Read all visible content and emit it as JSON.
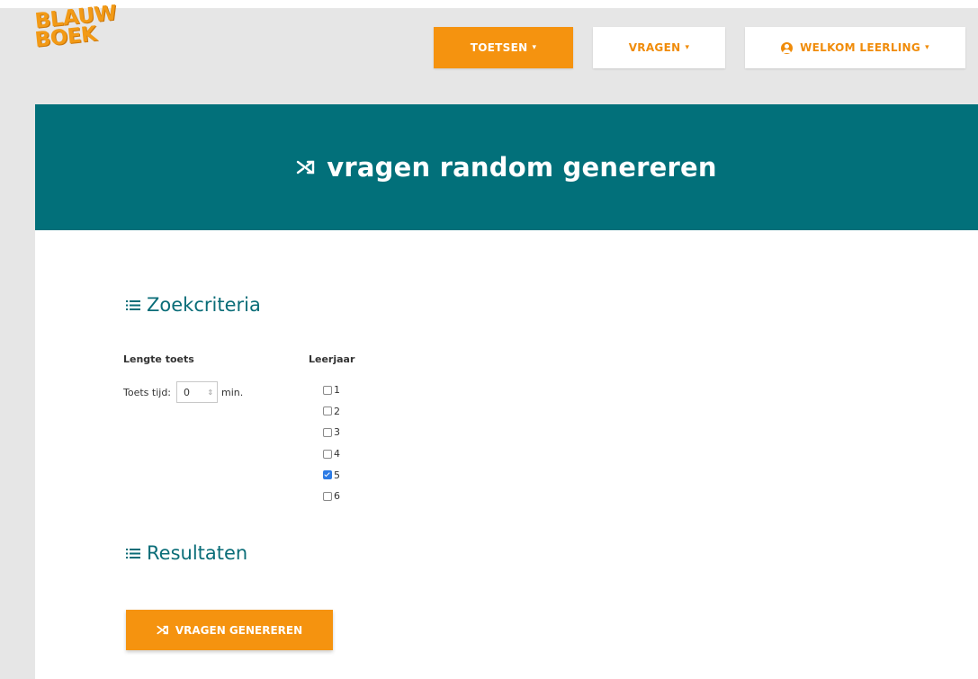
{
  "logo": {
    "line1": "BLAUW",
    "line2": "BOEK"
  },
  "nav": {
    "toetsen_label": "TOETSEN",
    "vragen_label": "VRAGEN",
    "welkom_label": "WELKOM LEERLING",
    "caret": "▾"
  },
  "hero": {
    "title": "vragen random genereren",
    "icon": "shuffle-icon"
  },
  "criteria": {
    "heading": "Zoekcriteria",
    "lengte_label": "Lengte toets",
    "time_label": "Toets tijd:",
    "time_value": "0",
    "time_unit": "min.",
    "leerjaar_label": "Leerjaar",
    "years": [
      {
        "label": "1",
        "checked": false
      },
      {
        "label": "2",
        "checked": false
      },
      {
        "label": "3",
        "checked": false
      },
      {
        "label": "4",
        "checked": false
      },
      {
        "label": "5",
        "checked": true
      },
      {
        "label": "6",
        "checked": false
      }
    ]
  },
  "results": {
    "heading": "Resultaten"
  },
  "generate_button": {
    "label": "VRAGEN GENEREREN",
    "icon": "shuffle-icon"
  },
  "colors": {
    "accent": "#f5930f",
    "hero": "#02707a",
    "heading": "#0a6d78",
    "checkbox": "#2d7be5"
  }
}
